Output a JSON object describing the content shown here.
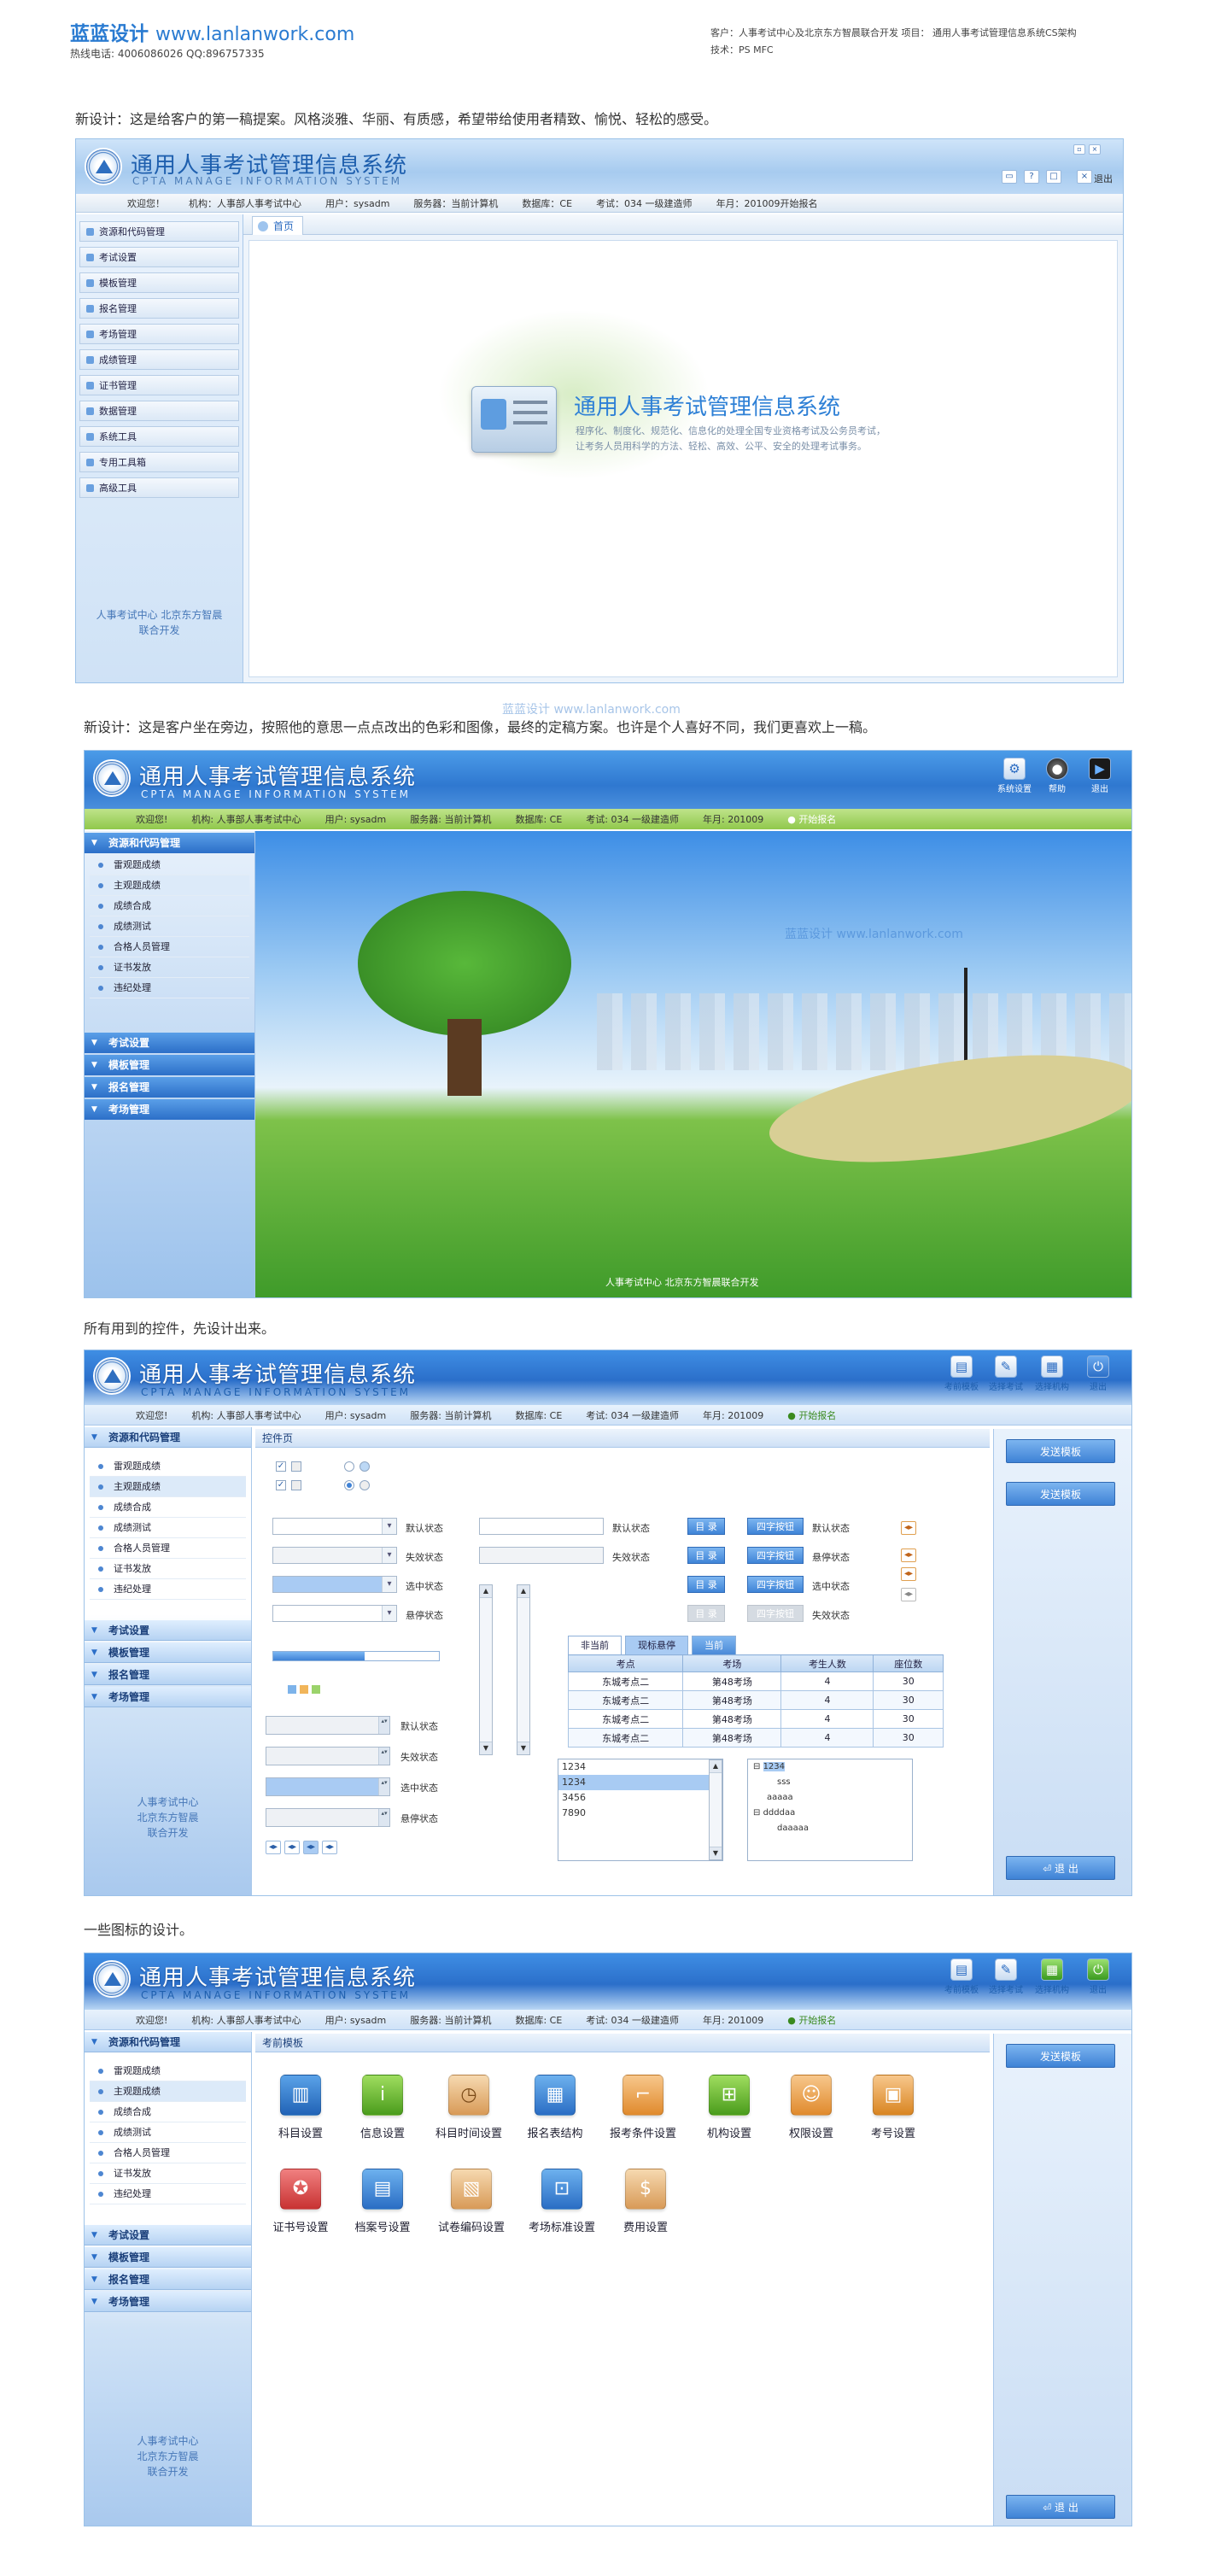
{
  "header": {
    "brand": "蓝蓝设计",
    "site": "www.lanlanwork.com",
    "contact": "热线电话: 4006086026    QQ:896757335",
    "client_line": "客户：人事考试中心及北京东方智晨联合开发      项目：  通用人事考试管理信息系统CS架构",
    "tech_line": "技术：PS  MFC"
  },
  "captions": {
    "c1": "新设计：这是给客户的第一稿提案。风格淡雅、华丽、有质感，希望带给使用者精致、愉悦、轻松的感受。",
    "c2": "新设计：这是客户坐在旁边，按照他的意思一点点改出的色彩和图像，最终的定稿方案。也许是个人喜好不同，我们更喜欢上一稿。",
    "c3": "所有用到的控件，先设计出来。",
    "c4": "一些图标的设计。"
  },
  "app": {
    "title": "通用人事考试管理信息系统",
    "subtitle": "CPTA MANAGE INFORMATION SYSTEM",
    "info": [
      "欢迎您！",
      "机构：人事部人事考试中心",
      "用户：sysadm",
      "服务器：当前计算机",
      "数据库：CE",
      "考试：034 一级建造师",
      "年月：201009开始报名"
    ],
    "info2": [
      "欢迎您!",
      "机构: 人事部人事考试中心",
      "用户: sysadm",
      "服务器: 当前计算机",
      "数据库: CE",
      "考试: 034 一级建造师",
      "年月: 201009"
    ],
    "start_label": "开始报名",
    "exit": "退出",
    "footer_credit": "人事考试中心  北京东方智晨联合开发"
  },
  "s1": {
    "nav": [
      "资源和代码管理",
      "考试设置",
      "模板管理",
      "报名管理",
      "考场管理",
      "成绩管理",
      "证书管理",
      "数据管理",
      "系统工具",
      "专用工具箱",
      "高级工具"
    ],
    "tab": "首页",
    "splash_title": "通用人事考试管理信息系统",
    "splash_desc1": "程序化、制度化、规范化、信息化的处理全国专业资格考试及公务员考试，",
    "splash_desc2": "让考务人员用科学的方法、轻松、高效、公平、安全的处理考试事务。",
    "sb_foot1": "人事考试中心  北京东方智晨",
    "sb_foot2": "联合开发",
    "watermark": "蓝蓝设计 www.lanlanwork.com"
  },
  "s2": {
    "tools": [
      "系统设置",
      "帮助",
      "退出"
    ],
    "nav_head": "资源和代码管理",
    "sub": [
      "雷观题成绩",
      "主观题成绩",
      "成绩合成",
      "成绩测试",
      "合格人员管理",
      "证书发放",
      "违纪处理"
    ],
    "heads": [
      "考试设置",
      "模板管理",
      "报名管理",
      "考场管理"
    ],
    "watermark": "蓝蓝设计 www.lanlanwork.com",
    "footer": "人事考试中心  北京东方智晨联合开发"
  },
  "s3": {
    "tools": [
      "考前模板",
      "选择考试",
      "选择机构",
      "退出"
    ],
    "nav_head": "资源和代码管理",
    "sub": [
      "雷观题成绩",
      "主观题成绩",
      "成绩合成",
      "成绩测试",
      "合格人员管理",
      "证书发放",
      "违纪处理"
    ],
    "heads": [
      "考试设置",
      "模板管理",
      "报名管理",
      "考场管理"
    ],
    "sb_foot": [
      "人事考试中心",
      "北京东方智晨",
      "联合开发"
    ],
    "panel_title": "控件页",
    "states": {
      "default": "默认状态",
      "disabled": "失效状态",
      "selected": "选中状态",
      "hover": "悬停状态"
    },
    "btn_dir": "目 录",
    "btn_4": "四字按钮",
    "tabs": [
      "非当前",
      "现标悬停",
      "当前"
    ],
    "table_headers": [
      "考点",
      "考场",
      "考生人数",
      "座位数"
    ],
    "table_rows": [
      [
        "东城考点二",
        "第48考场",
        "4",
        "30"
      ],
      [
        "东城考点二",
        "第48考场",
        "4",
        "30"
      ],
      [
        "东城考点二",
        "第48考场",
        "4",
        "30"
      ],
      [
        "东城考点二",
        "第48考场",
        "4",
        "30"
      ]
    ],
    "listbox": [
      "1234",
      "1234",
      "3456",
      "7890"
    ],
    "tree": [
      "1234",
      "sss",
      "aaaaa",
      "ddddaa",
      "daaaaa"
    ],
    "send_buttons": [
      "发送模板",
      "发送模板"
    ],
    "exit_button": "退 出"
  },
  "s4": {
    "tools": [
      "考前模板",
      "选择考试",
      "选择机构",
      "退出"
    ],
    "nav_head": "资源和代码管理",
    "sub": [
      "雷观题成绩",
      "主观题成绩",
      "成绩合成",
      "成绩测试",
      "合格人员管理",
      "证书发放",
      "违纪处理"
    ],
    "heads": [
      "考试设置",
      "模板管理",
      "报名管理",
      "考场管理"
    ],
    "sb_foot": [
      "人事考试中心",
      "北京东方智晨",
      "联合开发"
    ],
    "panel_title": "考前模板",
    "icons": [
      "科目设置",
      "信息设置",
      "科目时间设置",
      "报名表结构",
      "报考条件设置",
      "机构设置",
      "权限设置",
      "考号设置",
      "证书号设置",
      "档案号设置",
      "试卷编码设置",
      "考场标准设置",
      "费用设置"
    ],
    "send_button": "发送模板",
    "exit_button": "退 出"
  }
}
